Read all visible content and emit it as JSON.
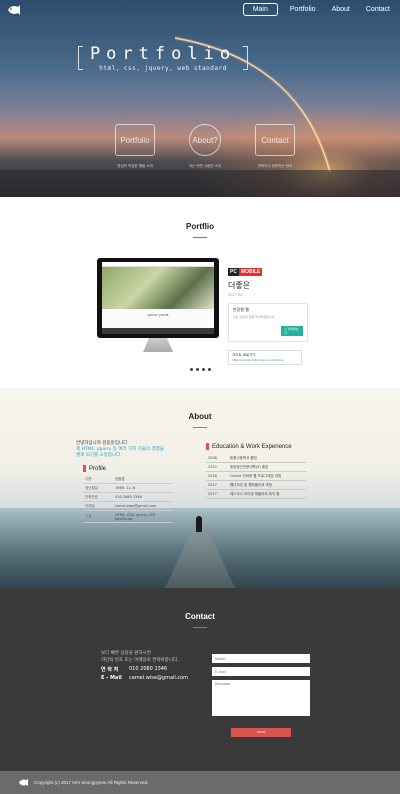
{
  "nav": {
    "logo_icon": "fish-logo-icon",
    "items": [
      {
        "label": "Main",
        "active": true
      },
      {
        "label": "Portfolio",
        "active": false
      },
      {
        "label": "About",
        "active": false
      },
      {
        "label": "Contact",
        "active": false
      }
    ]
  },
  "hero": {
    "title": "Portfolio",
    "subtitle": "html, css, jquery, web standard",
    "icons": [
      {
        "label": "Portfolio",
        "caption": "명심작 작업한 웹을 소개",
        "icon": "portfolio-icon"
      },
      {
        "label": "About?",
        "caption": "저는 어떤 사람인 소개",
        "icon": "person-icon"
      },
      {
        "label": "Contact",
        "caption": "연락하고 방문하는 연락",
        "icon": "briefcase-icon"
      }
    ]
  },
  "portfolio": {
    "title": "Portflio",
    "badge_a": "PC",
    "badge_b": "MOBILE",
    "project_name": "더좋은",
    "project_meta": "2017.04.",
    "box_heading": "반응형 웹",
    "box_text": "모든 반응형 웹을 제작하였습니다.",
    "box_button": "+ 자세히보기",
    "link_label": "사이트 바로가기",
    "link_url": "http://camel.dothome.co.kr/jhome",
    "screen_label": "ABOUT JHOME",
    "slides": 4
  },
  "about": {
    "title": "About",
    "intro_line1": "안녕하십니까 김동훈입니다",
    "intro_line2": "제 HTML, jquery 등 여러 가지 기술의 경험을",
    "intro_line3": "쌓게 되기를 소망합니다.",
    "profile_title": "Profile",
    "profile": [
      {
        "k": "이름",
        "v": "김동훈"
      },
      {
        "k": "생년월일",
        "v": "1989. 11. 8"
      },
      {
        "k": "전화번호",
        "v": "010 2080 1346"
      },
      {
        "k": "이메일",
        "v": "camel.wise@gmail.com"
      },
      {
        "k": "기술",
        "v": "HTML, CSS, Jquery, JSP, JavaScript"
      }
    ],
    "edu_title": "Education & Work Experience",
    "education": [
      {
        "k": "2008",
        "v": "동원고등학교 졸업"
      },
      {
        "k": "2012",
        "v": "동양공인전문대학(S) 졸업"
      },
      {
        "k": "2016",
        "v": "Oracle 자바와 웹 프로그래밍 과정"
      },
      {
        "k": "2017",
        "v": "웹디자인 및 웹퍼블리셔 과정"
      },
      {
        "k": "2017",
        "v": "에스오스 라이센 퍼블리셔 취직 중"
      }
    ]
  },
  "contact": {
    "title": "Contact",
    "text1": "보다 빠른 상담을 원하시면",
    "text2": "하단의 번호 또는 이메일로 연락바랍니다.",
    "phone_label": "연 락 처",
    "phone": "010 2080 1346",
    "email_label": "E - Mail",
    "email": "camel.wise@gmail.com",
    "name_placeholder": "Name",
    "email_placeholder": "E-mail",
    "message_placeholder": "Message",
    "send_label": "send"
  },
  "footer": {
    "copyright": "Copyright (c) 2017 Kim Seongpyeon All Rights Reserved."
  }
}
